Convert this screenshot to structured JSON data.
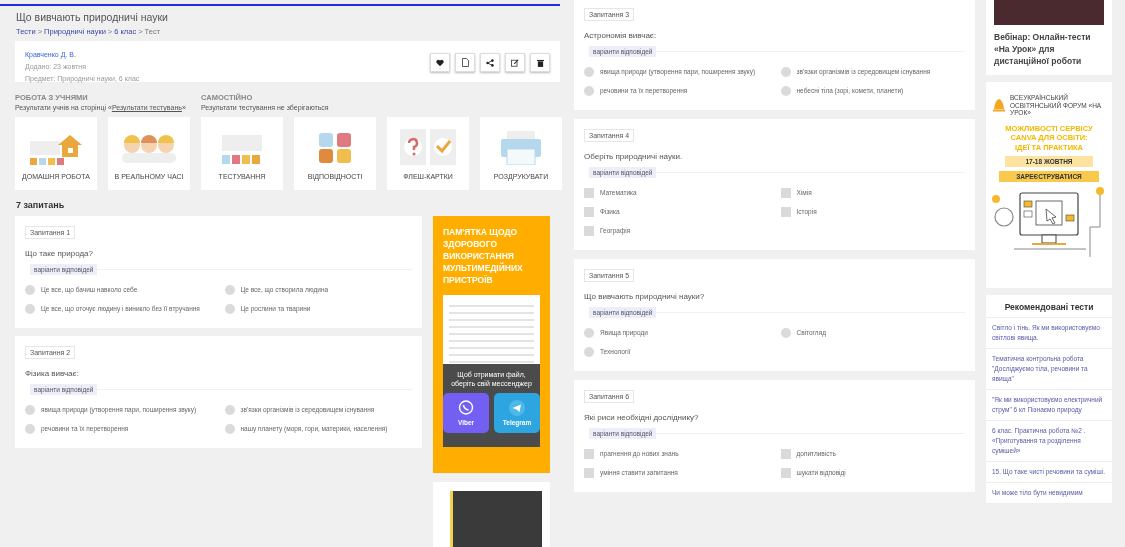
{
  "page": {
    "title": "Що вивчають природничі науки",
    "breadcrumbs": [
      {
        "label": "Тести",
        "kind": "link"
      },
      {
        "label": ">",
        "kind": "separator"
      },
      {
        "label": "Природничі науки",
        "kind": "link"
      },
      {
        "label": ">",
        "kind": "separator"
      },
      {
        "label": "6 клас",
        "kind": "link"
      },
      {
        "label": ">",
        "kind": "separator"
      },
      {
        "label": "Тест",
        "kind": "current"
      }
    ]
  },
  "info": {
    "author": "Кравченко Д. В.",
    "added": "Додано: 23 жовтня",
    "subject": "Предмет: Природничі науки, 6 клас"
  },
  "modes": [
    {
      "heading": "РОБОТА З УЧНЯМИ",
      "note": "Результати учнів на сторінці «",
      "note_link": "Результати тестувань",
      "note_end": "»"
    },
    {
      "heading": "САМОСТІЙНО",
      "note": "Результати тестування не зберігаються"
    }
  ],
  "tiles": [
    {
      "label": "ДОМАШНЯ РОБОТА"
    },
    {
      "label": "В РЕАЛЬНОМУ ЧАСІ"
    },
    {
      "label": "ТЕСТУВАННЯ"
    },
    {
      "label": "ВІДПОВІДНОСТІ"
    },
    {
      "label": "ФЛЕШ-КАРТКИ"
    },
    {
      "label": "РОЗДРУКУВАТИ"
    }
  ],
  "question_count": "7 запитань",
  "questions": [
    {
      "label": "Запитання 1",
      "text": "Що таке природа?",
      "options_label": "варіанти відповідей",
      "kind": "radio",
      "options": [
        {
          "text": "Це все, що бачиш навколо себе",
          "selected": false
        },
        {
          "text": "Це все, що створила людина",
          "selected": false
        },
        {
          "text": "Це все, що оточує людину і виникло без її втручання",
          "selected": false
        },
        {
          "text": "Це рослини та тварини",
          "selected": false
        }
      ]
    },
    {
      "label": "Запитання 2",
      "text": "Фізика вивчає:",
      "options_label": "варіанти відповідей",
      "kind": "radio",
      "options": [
        {
          "text": "явища природи (утворення пари, поширення звуку)",
          "selected": false
        },
        {
          "text": "зв'язки організмів із середовищем існування",
          "selected": false
        },
        {
          "text": "речовини та їх перетворення",
          "selected": false
        },
        {
          "text": "нашу планету (моря, гори, материки, населення)",
          "selected": false
        }
      ]
    },
    {
      "label": "Запитання 3",
      "text": "Астрономія вивчає:",
      "options_label": "варіанти відповідей",
      "kind": "radio",
      "options": [
        {
          "text": "явища природи (утворення пари, поширення звуку)",
          "selected": false
        },
        {
          "text": "зв'язки організмів із середовищем існування",
          "selected": false
        },
        {
          "text": "речовини та їх перетворення",
          "selected": false
        },
        {
          "text": "небесні тіла (зорі, комети, планети)",
          "selected": false
        }
      ]
    },
    {
      "label": "Запитання 4",
      "text": "Оберіть природничі науки.",
      "options_label": "варіанти відповідей",
      "kind": "checkbox",
      "options": [
        {
          "text": "Математика",
          "selected": false
        },
        {
          "text": "Хімія",
          "selected": false
        },
        {
          "text": "Фізика",
          "selected": false
        },
        {
          "text": "Історія",
          "selected": false
        },
        {
          "text": "Географія",
          "selected": false
        }
      ]
    },
    {
      "label": "Запитання 5",
      "text": "Що вивчають природничі науки?",
      "options_label": "варіанти відповідей",
      "kind": "radio",
      "options": [
        {
          "text": "Явища природи",
          "selected": false
        },
        {
          "text": "Світогляд",
          "selected": false
        },
        {
          "text": "Технології",
          "selected": false
        }
      ]
    },
    {
      "label": "Запитання 6",
      "text": "Які риси необхідні досліднику?",
      "options_label": "варіанти відповідей",
      "kind": "checkbox",
      "options": [
        {
          "text": "прагнення до нових знань",
          "selected": false
        },
        {
          "text": "допитливість",
          "selected": false
        },
        {
          "text": "уміння ставити запитання",
          "selected": false
        },
        {
          "text": "шукати відповіді",
          "selected": false
        }
      ]
    }
  ],
  "ad": {
    "title": "ПАМ'ЯТКА ЩОДО ЗДОРОВОГО ВИКОРИСТАННЯ МУЛЬТИМЕДІЙНИХ ПРИСТРОЇВ",
    "overlay_text": "Щоб отримати файл, оберіть свій мессенджер",
    "buttons": [
      {
        "label": "Viber",
        "kind": "viber"
      },
      {
        "label": "Telegram",
        "kind": "telegram"
      }
    ]
  },
  "webinar": {
    "title": "Вебінар: Онлайн-тести «На Урок» для дистанційної роботи"
  },
  "forum": {
    "org": "ВСЕУКРАЇНСЬКИЙ ОСВІТЯНСЬКИЙ ФОРУМ «НА УРОК»",
    "title": "МОЖЛИВОСТІ СЕРВІСУ CANVA ДЛЯ ОСВІТИ: ІДЕЇ ТА ПРАКТИКА",
    "dates": "17-18 ЖОВТНЯ",
    "button": "ЗАРЕЄСТРУВАТИСЯ"
  },
  "recommended": {
    "title": "Рекомендовані тести",
    "items": [
      "Світло і тінь. Як ми використовуємо світлові явища.",
      "Тематична контрольна робота \"Досліджуємо тіла, речовини та явища\"",
      "\"Як ми використовуємо електричний струм\" 6 кл Пізнаємо природу",
      "6 клас. Практична робота №2 . «Приготування та розділення сумішей»",
      "15. Що таке чисті речовини та суміші.",
      "Чи може тіло бути невидимим"
    ]
  }
}
